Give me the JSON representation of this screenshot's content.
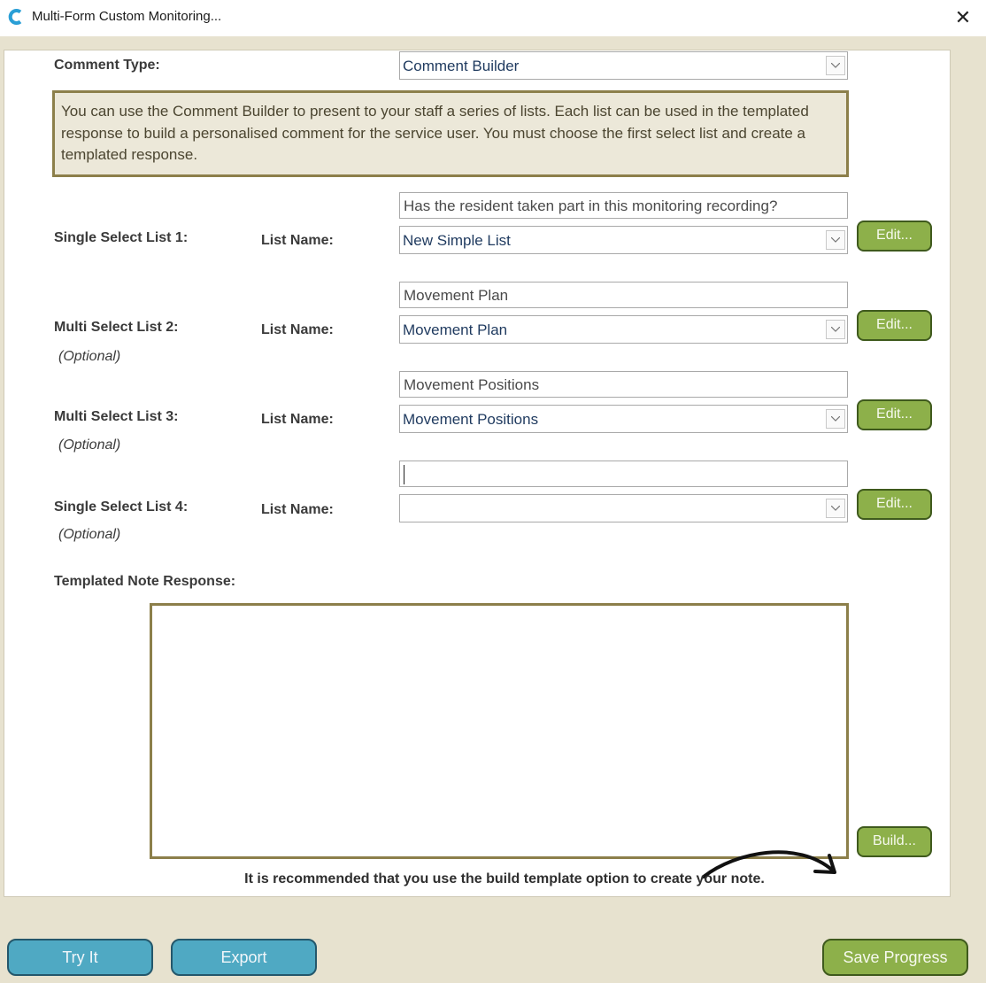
{
  "window": {
    "title": "Multi-Form Custom Monitoring...",
    "close_glyph": "✕"
  },
  "comment_type": {
    "label": "Comment Type:",
    "value": "Comment Builder"
  },
  "info_text": "You can use the Comment Builder to present to your staff a series of lists.  Each list can be used in the templated response to build a personalised comment for the service user. You must choose the first select list and create a templated response.",
  "lists": [
    {
      "label": "Single Select List 1:",
      "optional": "",
      "name_label": "List Name:",
      "question": "Has the resident taken part in this monitoring recording?",
      "list_name": "New Simple List",
      "edit_label": "Edit..."
    },
    {
      "label": "Multi Select List 2:",
      "optional": "(Optional)",
      "name_label": "List Name:",
      "question": "Movement Plan",
      "list_name": "Movement Plan",
      "edit_label": "Edit..."
    },
    {
      "label": "Multi Select List 3:",
      "optional": "(Optional)",
      "name_label": "List Name:",
      "question": "Movement Positions",
      "list_name": "Movement Positions",
      "edit_label": "Edit..."
    },
    {
      "label": "Single Select List 4:",
      "optional": "(Optional)",
      "name_label": "List Name:",
      "question": "",
      "list_name": "",
      "edit_label": "Edit..."
    }
  ],
  "templated": {
    "label": "Templated Note Response:",
    "value": "",
    "build_label": "Build...",
    "note": "It is recommended that you use the build template option to create your note."
  },
  "footer": {
    "try_label": "Try It",
    "export_label": "Export",
    "save_label": "Save Progress"
  },
  "colors": {
    "accent_green": "#8db04a",
    "accent_blue": "#4fa9c3",
    "frame_olive": "#8c7f4a"
  }
}
